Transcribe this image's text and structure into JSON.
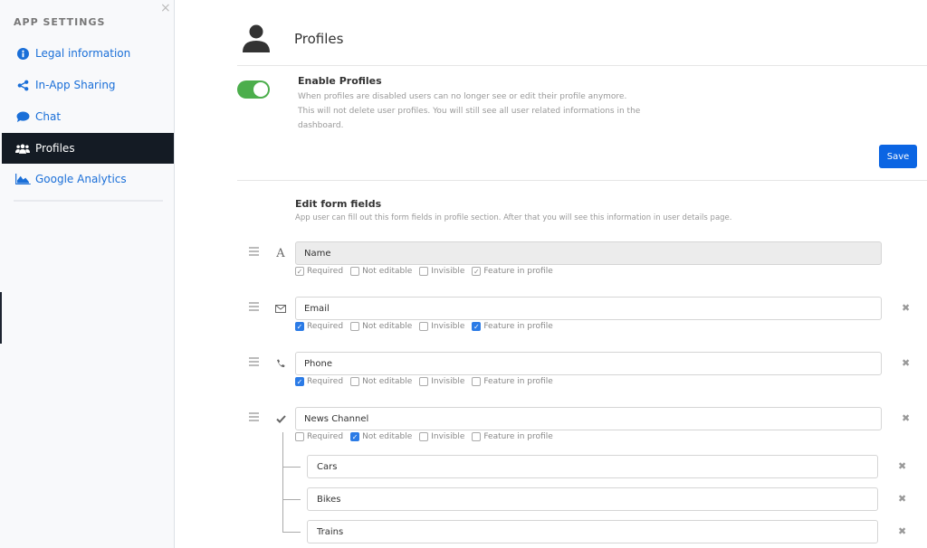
{
  "sidebar": {
    "heading": "APP SETTINGS",
    "close_icon": "×",
    "items": [
      {
        "label": "Legal information",
        "icon": "info-circle-icon",
        "active": false
      },
      {
        "label": "In-App Sharing",
        "icon": "share-icon",
        "active": false
      },
      {
        "label": "Chat",
        "icon": "chat-bubble-icon",
        "active": false
      },
      {
        "label": "Profiles",
        "icon": "users-icon",
        "active": true
      },
      {
        "label": "Google Analytics",
        "icon": "area-chart-icon",
        "active": false
      }
    ]
  },
  "header": {
    "title": "Profiles",
    "icon": "user-icon"
  },
  "enable": {
    "title": "Enable Profiles",
    "description": "When profiles are disabled users can no longer see or edit their profile anymore. This will not delete user profiles. You will still see all user related informations in the dashboard.",
    "enabled": true,
    "save_label": "Save"
  },
  "form": {
    "title": "Edit form fields",
    "description": "App user can fill out this form fields in profile section. After that you will see this information in user details page.",
    "option_labels": [
      "Required",
      "Not editable",
      "Invisible",
      "Feature in profile"
    ],
    "fields": [
      {
        "value": "Name",
        "type_icon": "text-A",
        "disabled": true,
        "removable": false,
        "options": [
          true,
          false,
          false,
          true
        ]
      },
      {
        "value": "Email",
        "type_icon": "envelope",
        "disabled": false,
        "removable": true,
        "options": [
          true,
          false,
          false,
          true
        ]
      },
      {
        "value": "Phone",
        "type_icon": "phone",
        "disabled": false,
        "removable": true,
        "options": [
          true,
          false,
          false,
          false
        ]
      },
      {
        "value": "News Channel",
        "type_icon": "check",
        "disabled": false,
        "removable": true,
        "options": [
          false,
          true,
          false,
          false
        ],
        "choices": [
          "Cars",
          "Bikes",
          "Trains"
        ]
      }
    ],
    "remove_icon": "✖"
  }
}
